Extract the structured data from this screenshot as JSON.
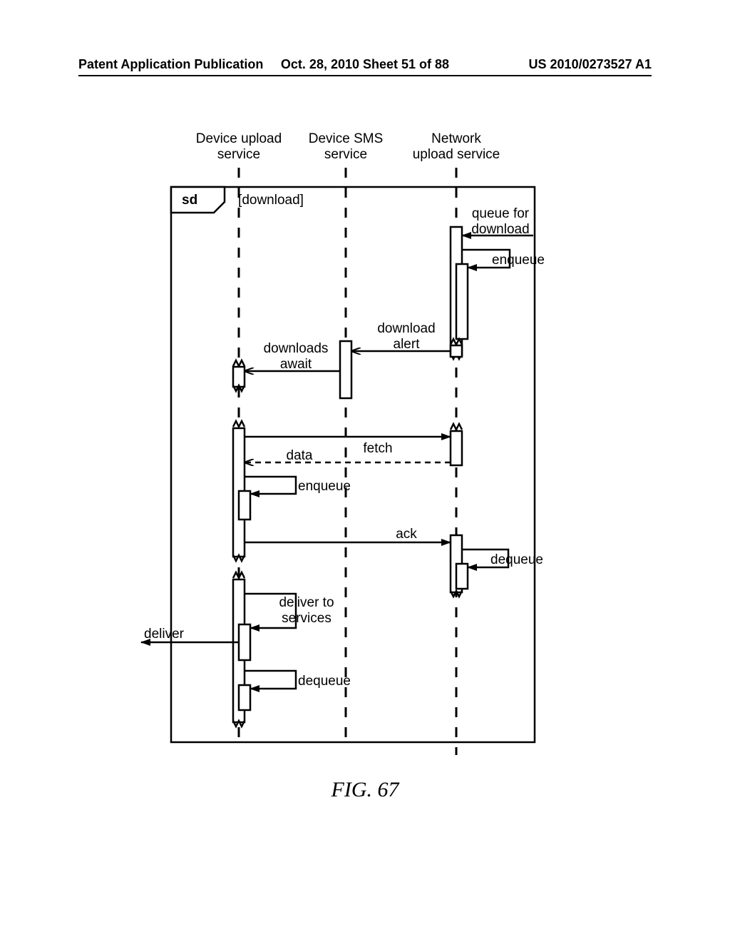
{
  "header": {
    "left": "Patent Application Publication",
    "mid": "Oct. 28, 2010  Sheet 51 of 88",
    "right": "US 2010/0273527 A1"
  },
  "lifelines": {
    "l1_line1": "Device upload",
    "l1_line2": "service",
    "l2_line1": "Device SMS",
    "l2_line2": "service",
    "l3_line1": "Network",
    "l3_line2": "upload service"
  },
  "frame": {
    "sd": "sd",
    "guard": "[download]"
  },
  "messages": {
    "queue_for_l1": "queue for",
    "queue_for_l2": "download",
    "enqueue": "enqueue",
    "download_l1": "download",
    "download_l2": "alert",
    "downloads_l1": "downloads",
    "downloads_l2": "await",
    "fetch": "fetch",
    "data": "data",
    "enqueue2": "enqueue",
    "ack": "ack",
    "dequeue": "dequeue",
    "deliver_to_l1": "deliver to",
    "deliver_to_l2": "services",
    "deliver": "deliver",
    "dequeue2": "dequeue"
  },
  "caption": "FIG. 67"
}
